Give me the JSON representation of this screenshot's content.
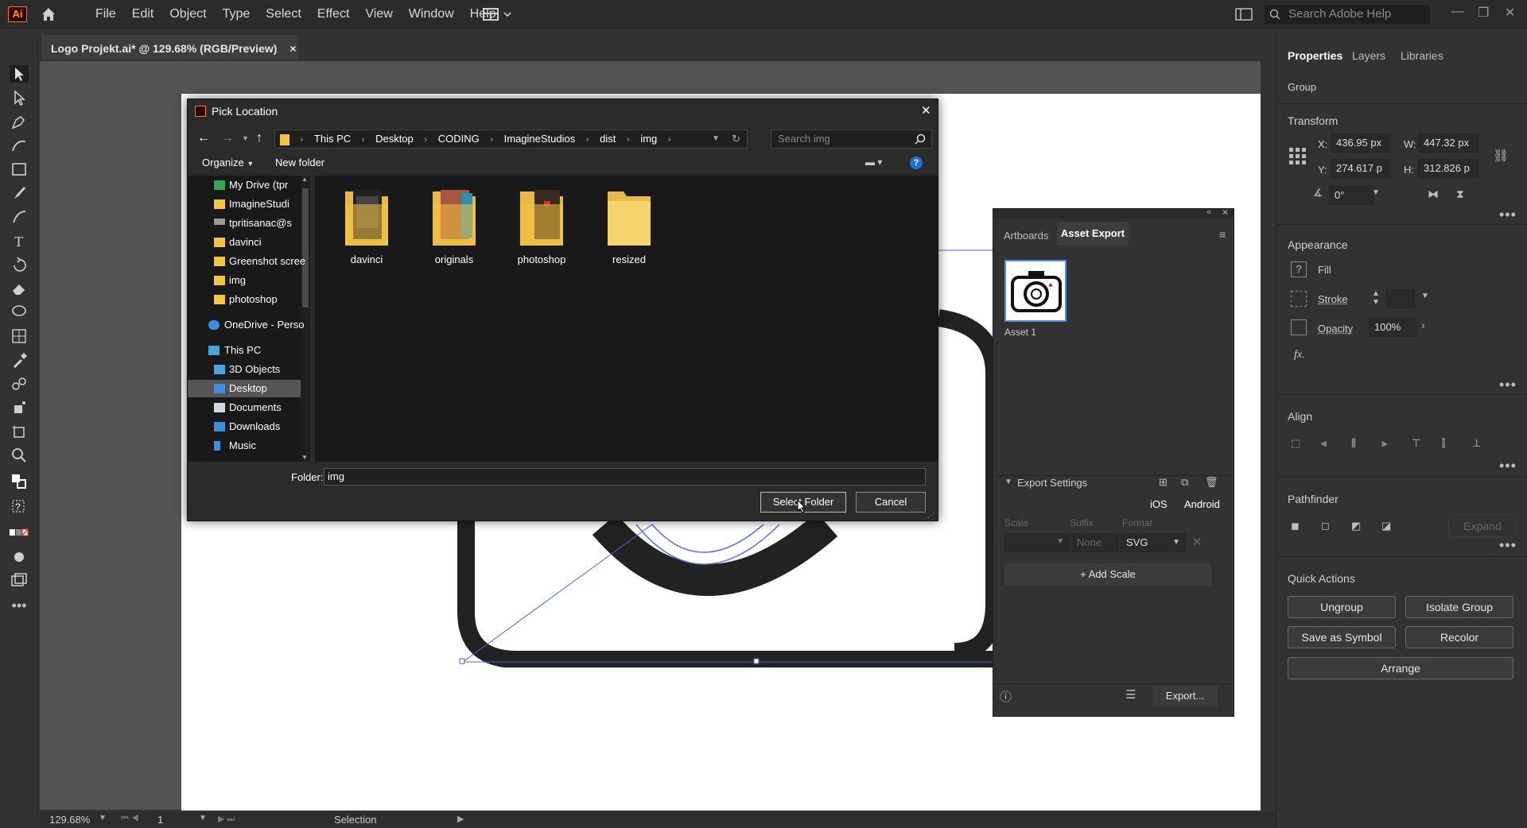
{
  "app": {
    "logo": "Ai",
    "menu": [
      "File",
      "Edit",
      "Object",
      "Type",
      "Select",
      "Effect",
      "View",
      "Window",
      "Help"
    ],
    "search_placeholder": "Search Adobe Help"
  },
  "document": {
    "tab_title": "Logo Projekt.ai* @ 129.68% (RGB/Preview)",
    "tab_close": "×"
  },
  "status": {
    "zoom": "129.68%",
    "artboard_num": "1",
    "tool_name": "Selection"
  },
  "dialog": {
    "title": "Pick Location",
    "breadcrumbs": [
      "This PC",
      "Desktop",
      "CODING",
      "ImagineStudios",
      "dist",
      "img"
    ],
    "search_placeholder": "Search img",
    "organize": "Organize",
    "new_folder": "New folder",
    "nav_items": [
      {
        "label": "My Drive (tpr",
        "icon": "drive-icon"
      },
      {
        "label": "ImagineStudi",
        "icon": "folder-icon"
      },
      {
        "label": "tpritisanac@s",
        "icon": "network-drive-icon"
      },
      {
        "label": "davinci",
        "icon": "folder-icon"
      },
      {
        "label": "Greenshot scree",
        "icon": "folder-icon"
      },
      {
        "label": "img",
        "icon": "folder-icon"
      },
      {
        "label": "photoshop",
        "icon": "folder-icon"
      },
      {
        "label": "OneDrive - Persor",
        "icon": "cloud-icon"
      },
      {
        "label": "This PC",
        "icon": "pc-icon"
      },
      {
        "label": "3D Objects",
        "icon": "cube-icon"
      },
      {
        "label": "Desktop",
        "icon": "desktop-icon"
      },
      {
        "label": "Documents",
        "icon": "documents-icon"
      },
      {
        "label": "Downloads",
        "icon": "download-icon"
      },
      {
        "label": "Music",
        "icon": "music-icon"
      }
    ],
    "folders": [
      "davinci",
      "originals",
      "photoshop",
      "resized"
    ],
    "folder_label": "Folder:",
    "folder_value": "img",
    "select_button": "Select Folder",
    "cancel_button": "Cancel"
  },
  "asset_export": {
    "tabs": [
      "Artboards",
      "Asset Export"
    ],
    "asset_name": "Asset 1",
    "export_settings": "Export Settings",
    "ios": "iOS",
    "android": "Android",
    "col_scale": "Scale",
    "col_suffix": "Suffix",
    "col_format": "Format",
    "suffix_placeholder": "None",
    "format_value": "SVG",
    "add_scale": "Add Scale",
    "export_button": "Export..."
  },
  "properties": {
    "tabs": [
      "Properties",
      "Layers",
      "Libraries"
    ],
    "group_label": "Group",
    "transform_label": "Transform",
    "x_label": "X:",
    "x_value": "436.95 px",
    "y_label": "Y:",
    "y_value": "274.617 p",
    "w_label": "W:",
    "w_value": "447.32 px",
    "h_label": "H:",
    "h_value": "312.826 p",
    "angle_value": "0°",
    "appearance_label": "Appearance",
    "fill_label": "Fill",
    "stroke_label": "Stroke",
    "opacity_label": "Opacity",
    "opacity_value": "100%",
    "fx_label": "fx.",
    "align_label": "Align",
    "pathfinder_label": "Pathfinder",
    "expand_label": "Expand",
    "quick_actions_label": "Quick Actions",
    "ungroup": "Ungroup",
    "isolate_group": "Isolate Group",
    "save_as_symbol": "Save as Symbol",
    "recolor": "Recolor",
    "arrange": "Arrange"
  }
}
